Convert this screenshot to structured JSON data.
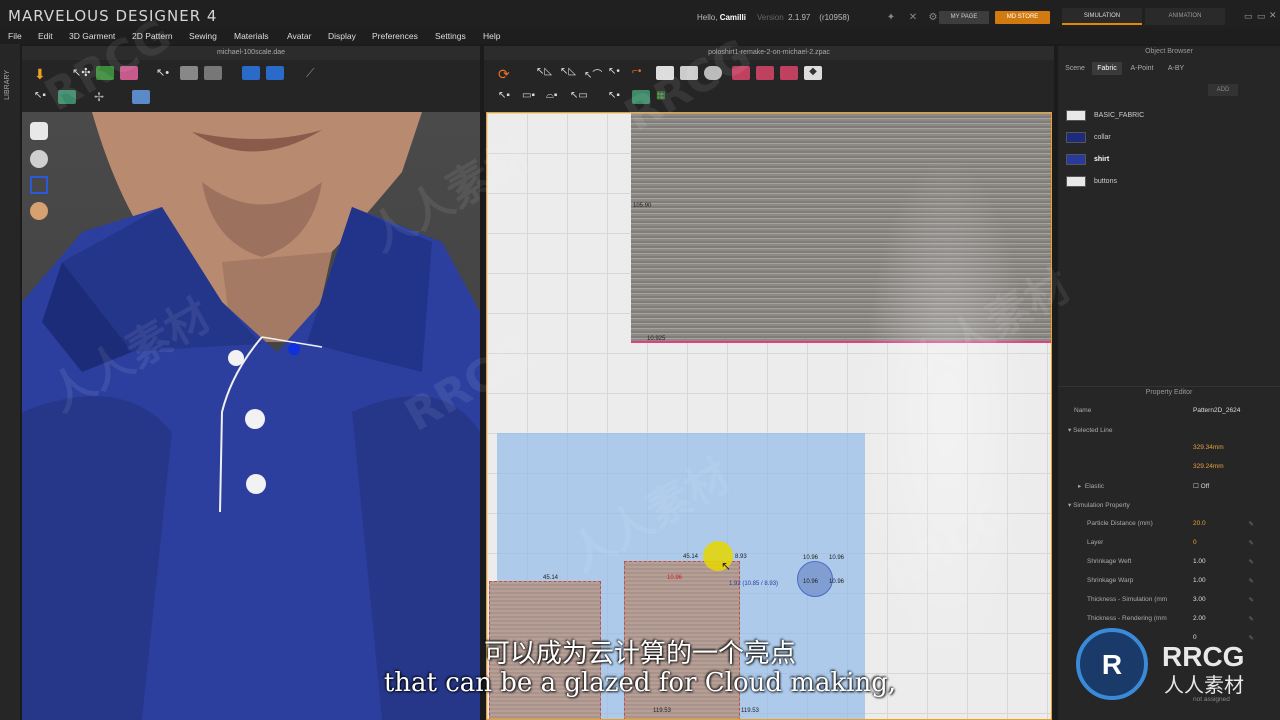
{
  "app": {
    "brand": "MARVELOUS DESIGNER 4",
    "greeting_prefix": "Hello,",
    "user": "Camilli",
    "version_label": "Version",
    "version": "2.1.97",
    "build": "(r10958)",
    "my_page": "MY PAGE",
    "md_store": "MD STORE",
    "mode_simulation": "SIMULATION",
    "mode_animation": "ANIMATION"
  },
  "menu": [
    "File",
    "Edit",
    "3D Garment",
    "2D Pattern",
    "Sewing",
    "Materials",
    "Avatar",
    "Display",
    "Preferences",
    "Settings",
    "Help"
  ],
  "library_label": "LIBRARY",
  "view3d": {
    "title": "michael-100scale.dae"
  },
  "view2d": {
    "title": "poloshirt1-remake-2-on-michael-2.zpac",
    "measurements": {
      "top_left": "105.90",
      "top_bottom": "10.925",
      "a": "45.14",
      "b": "45.14",
      "c": "8.93",
      "d": "1.92 (10.85 / 8.93)",
      "r1": "10.96",
      "r2": "10.96",
      "r3": "10.96",
      "r4": "10.96",
      "bot1": "119.53",
      "bot2": "119.53",
      "red": "10.96"
    }
  },
  "object_browser": {
    "title": "Object Browser",
    "tabs": [
      "Scene",
      "Fabric",
      "A-Point",
      "A-BY"
    ],
    "active_tab": "Fabric",
    "add_label": "ADD",
    "fabrics": [
      {
        "name": "BASIC_FABRIC",
        "color": "#e8e8e8"
      },
      {
        "name": "collar",
        "color": "#1e2a7a"
      },
      {
        "name": "shirt",
        "color": "#2a3a9a"
      },
      {
        "name": "buttons",
        "color": "#e8e8e8"
      }
    ]
  },
  "property_editor": {
    "title": "Property Editor",
    "name_label": "Name",
    "name_value": "Pattern2D_2624",
    "selected_line": "Selected Line",
    "line_length_1": "329.34mm",
    "line_length_2": "329.24mm",
    "elastic_label": "Elastic",
    "elastic_value": "Off",
    "sim_property": "Simulation Property",
    "rows": [
      {
        "label": "Particle Distance (mm)",
        "value": "20.0",
        "accent": true
      },
      {
        "label": "Layer",
        "value": "0",
        "accent": true
      },
      {
        "label": "Shrinkage Weft",
        "value": "1.00",
        "accent": false
      },
      {
        "label": "Shrinkage Warp",
        "value": "1.00",
        "accent": false
      },
      {
        "label": "Thickness - Simulation (mm",
        "value": "3.00",
        "accent": false
      },
      {
        "label": "Thickness - Rendering (mm",
        "value": "2.00",
        "accent": false
      },
      {
        "label": "",
        "value": "0",
        "accent": false
      }
    ],
    "not_assigned": "not assigned"
  },
  "subtitles": {
    "chinese": "可以成为云计算的一个亮点",
    "english": "that can be a glazed for Cloud making,"
  },
  "watermark": {
    "brand": "RRCG",
    "cn": "人人素材"
  },
  "colors": {
    "accent": "#e08a00",
    "shirt": "#2c3f9e",
    "selection": "#a8c8f0"
  }
}
